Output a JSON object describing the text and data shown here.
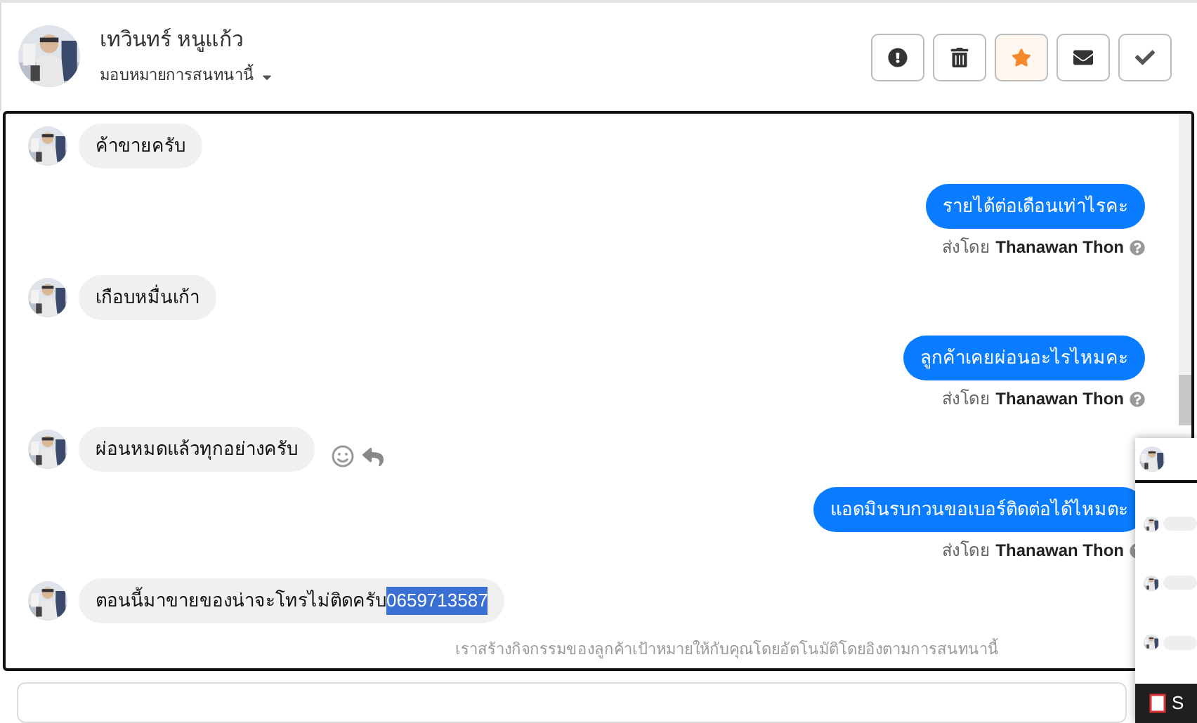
{
  "header": {
    "name": "เทวินทร์ หนูแก้ว",
    "assign_label": "มอบหมายการสนทนานี้"
  },
  "toolbar": [
    {
      "kind": "report",
      "on": false
    },
    {
      "kind": "delete",
      "on": false
    },
    {
      "kind": "star",
      "on": true
    },
    {
      "kind": "mail",
      "on": false
    },
    {
      "kind": "done",
      "on": false
    }
  ],
  "messages": [
    {
      "kind": "in",
      "text": "ค้าขายครับ",
      "show_actions": false
    },
    {
      "kind": "out",
      "text": "รายได้ต่อเดือนเท่าไรคะ",
      "sent_by_label": "ส่งโดย",
      "sender": "Thanawan Thon"
    },
    {
      "kind": "in",
      "text": "เกือบหมื่นเก้า",
      "show_actions": false
    },
    {
      "kind": "out",
      "text": "ลูกค้าเคยผ่อนอะไรไหมคะ",
      "sent_by_label": "ส่งโดย",
      "sender": "Thanawan Thon"
    },
    {
      "kind": "in",
      "text": "ผ่อนหมดแล้วทุกอย่างครับ",
      "show_actions": true
    },
    {
      "kind": "out",
      "text": "แอดมินรบกวนขอเบอร์ติดต่อได้ไหมตะ",
      "sent_by_label": "ส่งโดย",
      "sender": "Thanawan Thon"
    },
    {
      "kind": "in",
      "text": "ตอนนี้มาขายของน่าจะโทรไม่ติดครับ",
      "selected_text": "0659713587",
      "show_actions": false
    }
  ],
  "footer_note": "เราสร้างกิจกรรมของลูกค้าเป้าหมายให้กับคุณโดยอัตโนมัติโดยอิงตามการสนทนานี้",
  "preview": {
    "taskbar_label": "S"
  }
}
